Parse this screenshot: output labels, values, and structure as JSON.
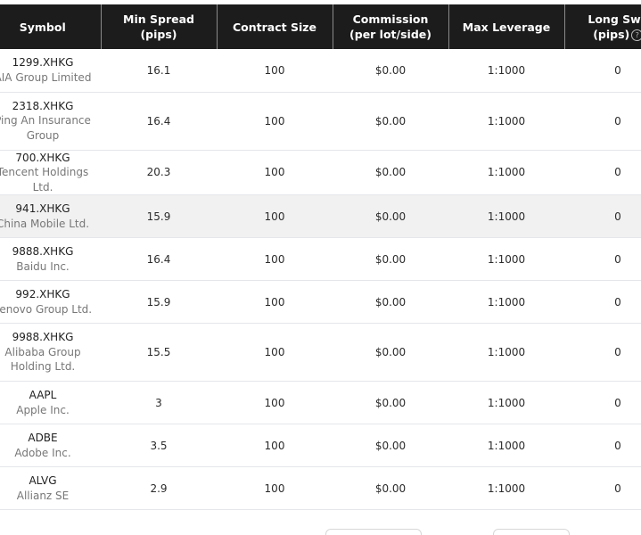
{
  "table": {
    "headers": [
      {
        "line1": "Symbol",
        "line2": ""
      },
      {
        "line1": "Min Spread",
        "line2": "(pips)"
      },
      {
        "line1": "Contract Size",
        "line2": ""
      },
      {
        "line1": "Commission",
        "line2": "(per lot/side)"
      },
      {
        "line1": "Max Leverage",
        "line2": ""
      },
      {
        "line1": "Long Swa",
        "line2": "(pips)"
      }
    ],
    "help_icon": "?",
    "rows": [
      {
        "code": "1299.XHKG",
        "name": "AIA Group Limited",
        "spread": "16.1",
        "contract": "100",
        "commission": "$0.00",
        "leverage": "1:1000",
        "swap": "0"
      },
      {
        "code": "2318.XHKG",
        "name": "Ping An Insurance Group",
        "spread": "16.4",
        "contract": "100",
        "commission": "$0.00",
        "leverage": "1:1000",
        "swap": "0"
      },
      {
        "code": "700.XHKG",
        "name": "Tencent Holdings Ltd.",
        "spread": "20.3",
        "contract": "100",
        "commission": "$0.00",
        "leverage": "1:1000",
        "swap": "0"
      },
      {
        "code": "941.XHKG",
        "name": "China Mobile Ltd.",
        "spread": "15.9",
        "contract": "100",
        "commission": "$0.00",
        "leverage": "1:1000",
        "swap": "0"
      },
      {
        "code": "9888.XHKG",
        "name": "Baidu Inc.",
        "spread": "16.4",
        "contract": "100",
        "commission": "$0.00",
        "leverage": "1:1000",
        "swap": "0"
      },
      {
        "code": "992.XHKG",
        "name": "Lenovo Group Ltd.",
        "spread": "15.9",
        "contract": "100",
        "commission": "$0.00",
        "leverage": "1:1000",
        "swap": "0"
      },
      {
        "code": "9988.XHKG",
        "name": "Alibaba Group Holding Ltd.",
        "spread": "15.5",
        "contract": "100",
        "commission": "$0.00",
        "leverage": "1:1000",
        "swap": "0"
      },
      {
        "code": "AAPL",
        "name": "Apple Inc.",
        "spread": "3",
        "contract": "100",
        "commission": "$0.00",
        "leverage": "1:1000",
        "swap": "0"
      },
      {
        "code": "ADBE",
        "name": "Adobe Inc.",
        "spread": "3.5",
        "contract": "100",
        "commission": "$0.00",
        "leverage": "1:1000",
        "swap": "0"
      },
      {
        "code": "ALVG",
        "name": "Allianz SE",
        "spread": "2.9",
        "contract": "100",
        "commission": "$0.00",
        "leverage": "1:1000",
        "swap": "0"
      }
    ]
  }
}
